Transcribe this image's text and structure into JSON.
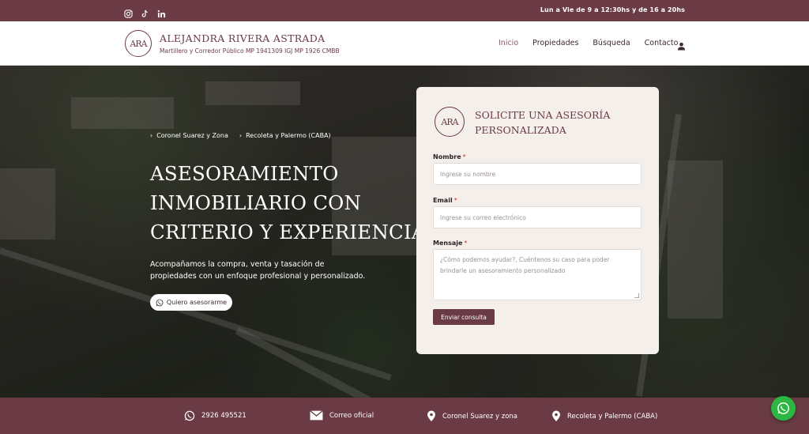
{
  "topbar": {
    "social": [
      "instagram-icon",
      "tiktok-icon",
      "linkedin-icon"
    ],
    "hours": "Lun a Vie de 9 a 12:30hs y de 16 a 20hs"
  },
  "header": {
    "logo_initials": "ARA",
    "brand_name": "ALEJANDRA RIVERA ASTRADA",
    "brand_sub": "Martillero y Corredor Público MP 1941309 IGJ MP 1926 CMBB",
    "nav": [
      {
        "label": "Inicio",
        "active": true
      },
      {
        "label": "Propiedades"
      },
      {
        "label": "Búsqueda"
      },
      {
        "label": "Contacto"
      }
    ]
  },
  "hero": {
    "crumbs": [
      "Coronel Suarez y Zona",
      "Recoleta y Palermo (CABA)"
    ],
    "title_lines": [
      "ASESORAMIENTO",
      "INMOBILIARIO CON",
      "CRITERIO Y EXPERIENCIA"
    ],
    "description": "Acompañamos la compra, venta y tasación de propiedades con un enfoque profesional y personalizado.",
    "cta_label": "Quiero asesorarme"
  },
  "form": {
    "title_lines": [
      "SOLICITE UNA ASESORÍA",
      "PERSONALIZADA"
    ],
    "name_label": "Nombre",
    "name_placeholder": "Ingrese su nombre",
    "email_label": "Email",
    "email_placeholder": "Ingrese su correo electrónico",
    "message_label": "Mensaje",
    "message_placeholder": "¿Cómo podemos ayudar?, Cuéntenos su caso para poder brindarle un asesoramiento personalizado",
    "required_mark": "*",
    "submit_label": "Enviar consulta"
  },
  "contact_bar": {
    "phone": "2926 495521",
    "mail": "Correo oficial",
    "location1": "Coronel Suarez y zona",
    "location2": "Recoleta y Palermo (CABA)"
  },
  "colors": {
    "brand": "#6a3b44",
    "whatsapp": "#2cb742"
  }
}
